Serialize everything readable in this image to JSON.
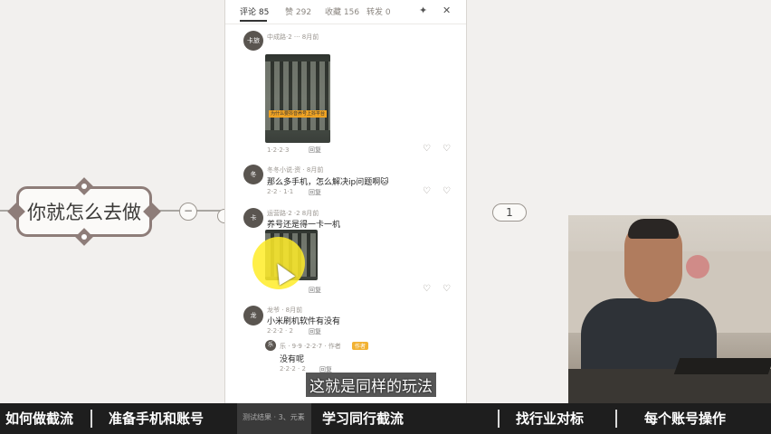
{
  "mindmap": {
    "node_text": "你就怎么去做",
    "collapse_symbol": "−",
    "badge_count": "1"
  },
  "panel": {
    "tabs": [
      {
        "label": "评论 85"
      },
      {
        "label": "赞 292"
      },
      {
        "label": "收藏 156"
      },
      {
        "label": "转发 0"
      }
    ],
    "pin_icon": "✦",
    "close_icon": "✕",
    "comments": [
      {
        "user": "中成路·2 ··· 8月前",
        "avatar_text": "卡旅",
        "text": "",
        "meta": "1·2·2·3",
        "reply": "回复",
        "thumb_caption": "为什么要抖音养号上抖平台"
      },
      {
        "user": "冬冬小说·资 · 8月前",
        "avatar_text": "冬",
        "text": "那么多手机，怎么解决ip问题啊🐱",
        "meta": "2-2 · 1·1",
        "reply": "回复"
      },
      {
        "user": "运营路·2 ·2 8月前",
        "avatar_text": "卡",
        "text": "养号还是得一卡一机",
        "meta": "",
        "reply": "回复"
      },
      {
        "user": "龙爷 · 8月前",
        "avatar_text": "龙",
        "text": "小米刷机软件有没有",
        "meta": "2·2·2 · 2",
        "reply": "回复"
      },
      {
        "user": "乐 · 9·9 ·2·2·7 · 作者",
        "avatar_text": "乐",
        "text": "没有呢",
        "meta": "2·2·2 · 2",
        "reply": "回复",
        "badge": "作者"
      }
    ]
  },
  "subtitle": "这就是同样的玩法",
  "chapters": [
    {
      "label": "如何做截流"
    },
    {
      "label": "准备手机和账号"
    },
    {
      "label": "测试结果 · 3、元素"
    },
    {
      "label": "学习同行截流"
    },
    {
      "label": "找行业对标"
    },
    {
      "label": "每个账号操作"
    }
  ],
  "colors": {
    "node_border": "#8e7d79",
    "cursor_halo": "#ffec28",
    "bottom_bar": "#1e1e1e"
  }
}
